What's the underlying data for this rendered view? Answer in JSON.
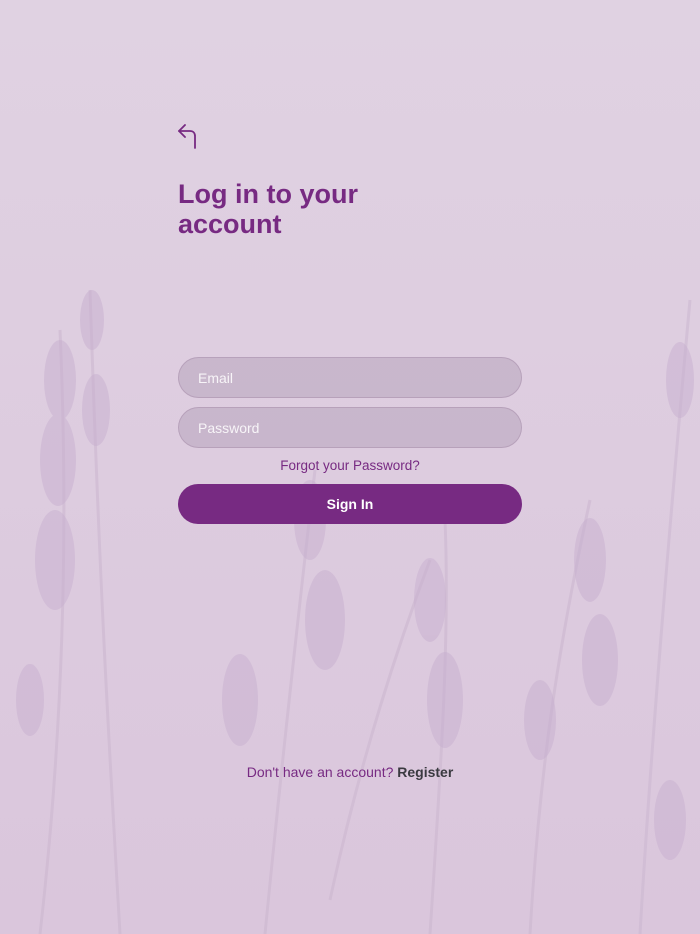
{
  "header": {
    "back_icon": "back-arrow-icon",
    "title": "Log in to your account"
  },
  "form": {
    "email_placeholder": "Email",
    "password_placeholder": "Password",
    "forgot_password": "Forgot your Password?",
    "sign_in_label": "Sign In"
  },
  "footer": {
    "prompt": "Don't have an account?",
    "register_label": "Register"
  },
  "colors": {
    "background": "#e0d0e2",
    "accent": "#772a82",
    "button_text": "#ffffff",
    "register_text": "#3a3a40"
  }
}
